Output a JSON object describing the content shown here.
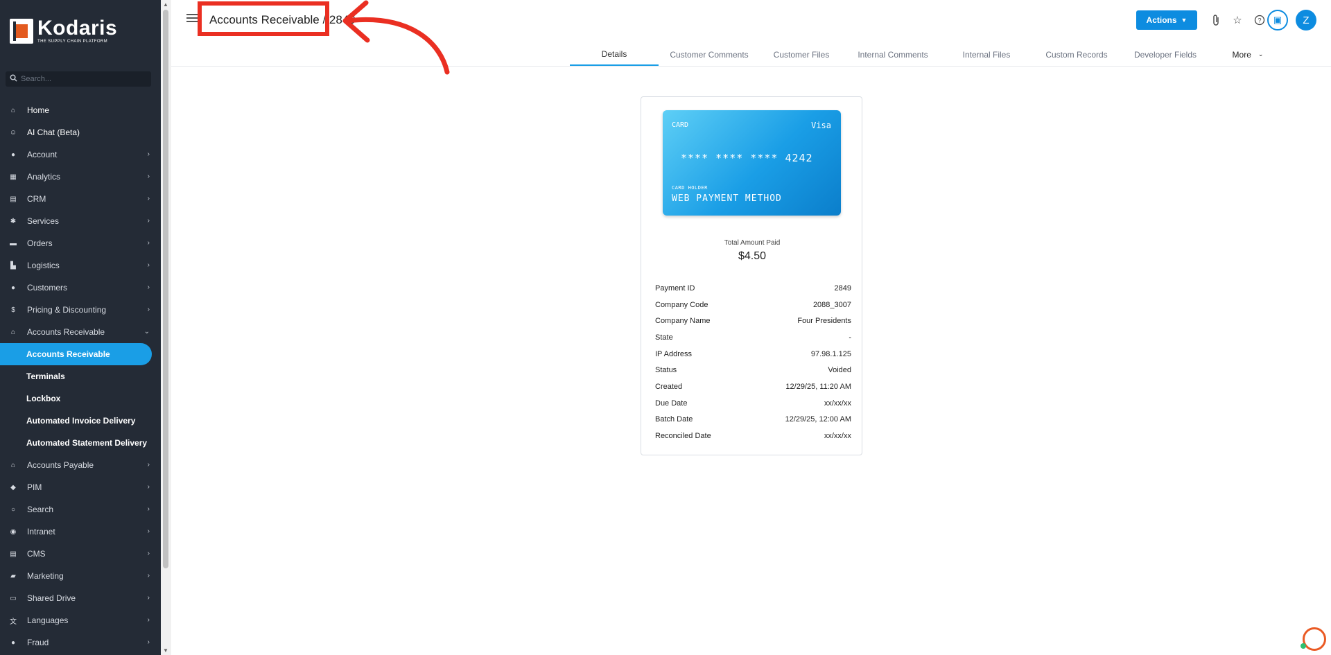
{
  "brand": {
    "name": "Kodaris",
    "tagline": "THE SUPPLY CHAIN PLATFORM"
  },
  "sidebar": {
    "search_placeholder": "Search...",
    "items": [
      {
        "label": "Home",
        "icon": "home-icon",
        "expandable": false
      },
      {
        "label": "AI Chat (Beta)",
        "icon": "robot-icon",
        "expandable": false
      },
      {
        "label": "Account",
        "icon": "user-icon",
        "expandable": true
      },
      {
        "label": "Analytics",
        "icon": "analytics-icon",
        "expandable": true
      },
      {
        "label": "CRM",
        "icon": "id-card-icon",
        "expandable": true
      },
      {
        "label": "Services",
        "icon": "services-icon",
        "expandable": true
      },
      {
        "label": "Orders",
        "icon": "truck-icon",
        "expandable": true
      },
      {
        "label": "Logistics",
        "icon": "forklift-icon",
        "expandable": true
      },
      {
        "label": "Customers",
        "icon": "users-icon",
        "expandable": true
      },
      {
        "label": "Pricing & Discounting",
        "icon": "dollar-icon",
        "expandable": true
      },
      {
        "label": "Accounts Receivable",
        "icon": "bank-icon",
        "expandable": true,
        "expanded": true
      }
    ],
    "sub_items": [
      {
        "label": "Accounts Receivable",
        "active": true
      },
      {
        "label": "Terminals",
        "active": false
      },
      {
        "label": "Lockbox",
        "active": false
      },
      {
        "label": "Automated Invoice Delivery",
        "active": false
      },
      {
        "label": "Automated Statement Delivery",
        "active": false
      }
    ],
    "items_after": [
      {
        "label": "Accounts Payable",
        "icon": "bank-icon"
      },
      {
        "label": "PIM",
        "icon": "tag-icon"
      },
      {
        "label": "Search",
        "icon": "search-icon"
      },
      {
        "label": "Intranet",
        "icon": "globe-icon"
      },
      {
        "label": "CMS",
        "icon": "cms-icon"
      },
      {
        "label": "Marketing",
        "icon": "megaphone-icon"
      },
      {
        "label": "Shared Drive",
        "icon": "folder-icon"
      },
      {
        "label": "Languages",
        "icon": "translate-icon"
      },
      {
        "label": "Fraud",
        "icon": "alert-icon"
      }
    ]
  },
  "header": {
    "title": "Accounts Receivable / 2849",
    "actions_label": "Actions",
    "avatar_initial": "Z",
    "tabs": [
      {
        "label": "Details",
        "active": true
      },
      {
        "label": "Customer Comments",
        "active": false
      },
      {
        "label": "Customer Files",
        "active": false
      },
      {
        "label": "Internal Comments",
        "active": false
      },
      {
        "label": "Internal Files",
        "active": false
      },
      {
        "label": "Custom Records",
        "active": false
      },
      {
        "label": "Developer Fields",
        "active": false
      },
      {
        "label": "More",
        "active": false
      }
    ]
  },
  "card": {
    "label": "CARD",
    "brand": "Visa",
    "number": "**** **** **** 4242",
    "holder_label": "CARD HOLDER",
    "holder": "WEB PAYMENT METHOD"
  },
  "payment": {
    "total_label": "Total Amount Paid",
    "total_value": "$4.50",
    "rows": [
      {
        "label": "Payment ID",
        "value": "2849"
      },
      {
        "label": "Company Code",
        "value": "2088_3007"
      },
      {
        "label": "Company Name",
        "value": "Four Presidents"
      },
      {
        "label": "State",
        "value": "-"
      },
      {
        "label": "IP Address",
        "value": "97.98.1.125"
      },
      {
        "label": "Status",
        "value": "Voided"
      },
      {
        "label": "Created",
        "value": "12/29/25, 11:20 AM"
      },
      {
        "label": "Due Date",
        "value": "xx/xx/xx"
      },
      {
        "label": "Batch Date",
        "value": "12/29/25, 12:00 AM"
      },
      {
        "label": "Reconciled Date",
        "value": "xx/xx/xx"
      }
    ]
  },
  "colors": {
    "sidebar_bg": "#242b36",
    "accent": "#1a9ee6",
    "annotation": "#ea2f22"
  }
}
